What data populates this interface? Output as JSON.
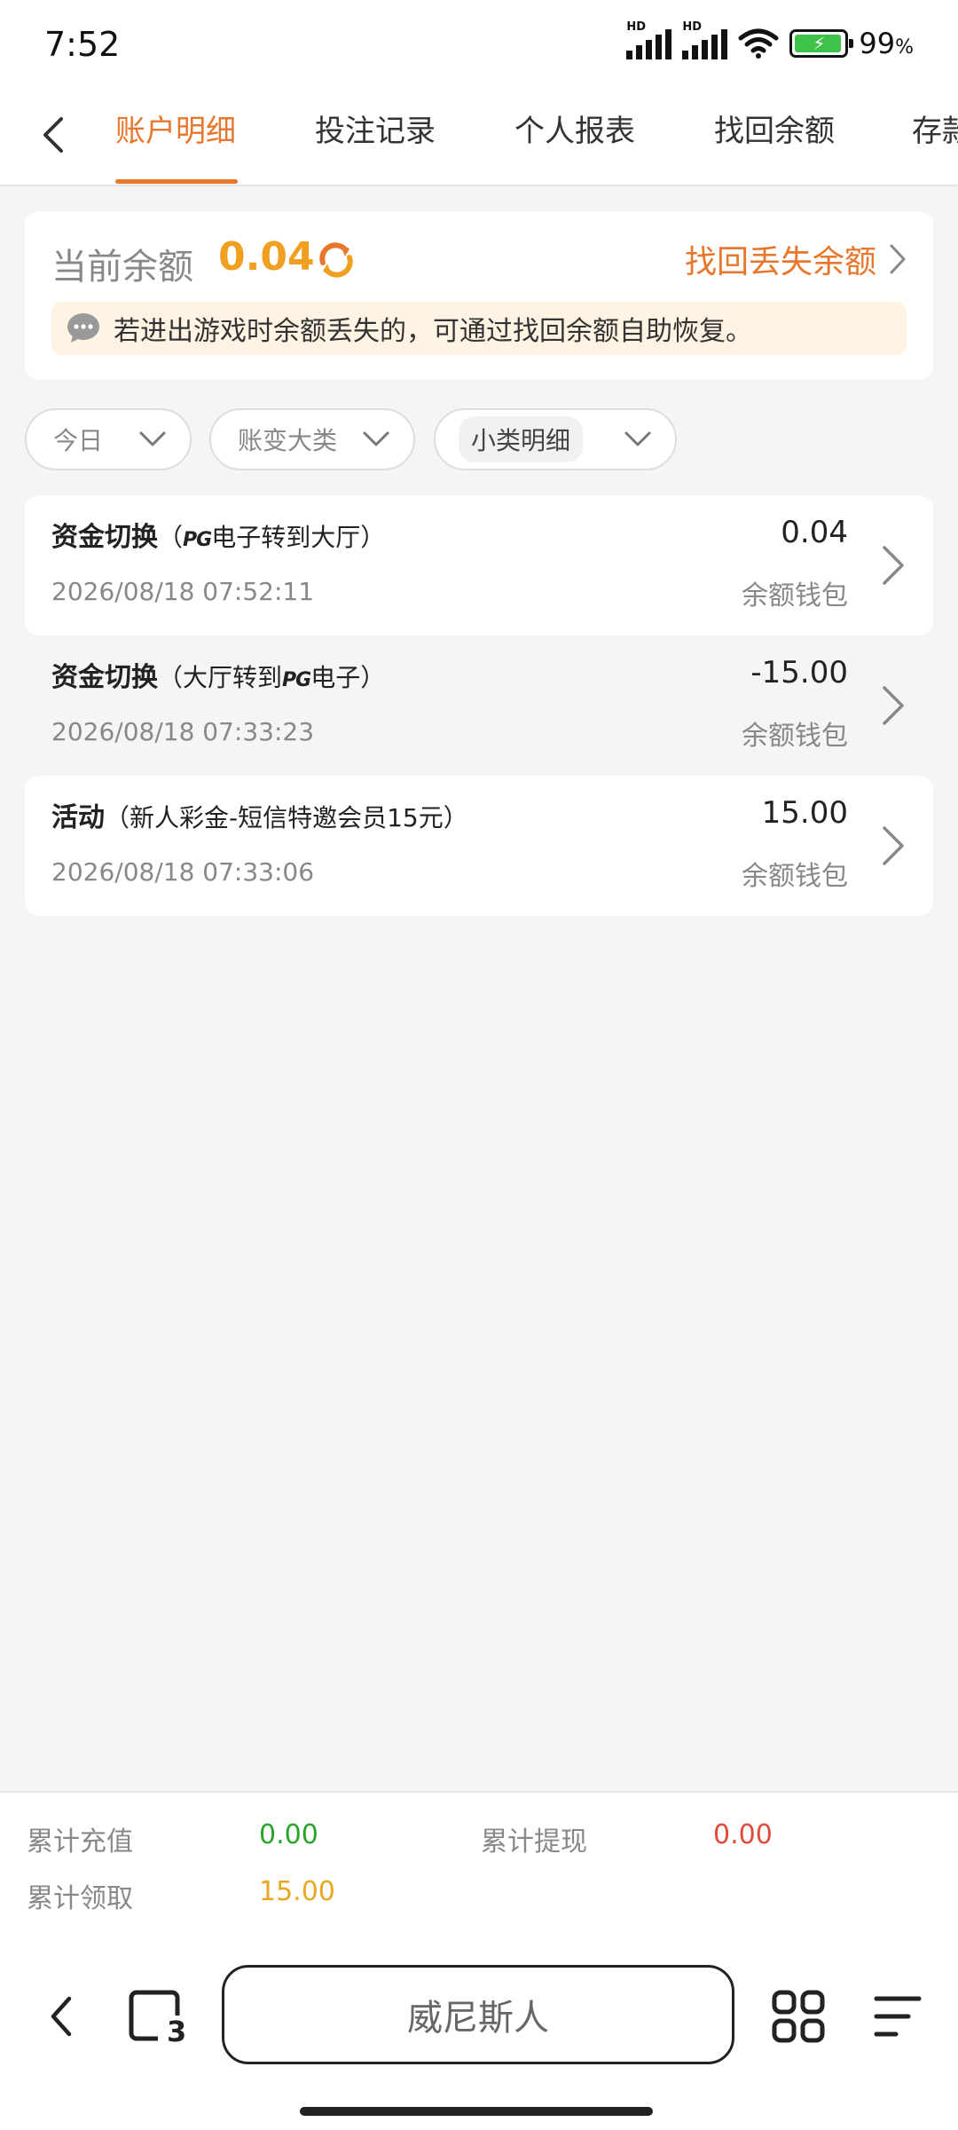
{
  "status_bar": {
    "time": "7:52",
    "battery_pct": "99",
    "battery_unit": "%"
  },
  "tabs": [
    {
      "label": "账户明细",
      "active": true
    },
    {
      "label": "投注记录"
    },
    {
      "label": "个人报表"
    },
    {
      "label": "找回余额"
    },
    {
      "label": "存款"
    }
  ],
  "balance": {
    "label": "当前余额",
    "value": "0.04",
    "recover_link": "找回丢失余额",
    "notice": "若进出游戏时余额丢失的，可通过找回余额自助恢复。"
  },
  "filters": [
    {
      "label": "今日"
    },
    {
      "label": "账变大类"
    },
    {
      "label": "小类明细"
    }
  ],
  "transactions": [
    {
      "type": "资金切换",
      "desc_pre": "（",
      "desc_logo": "PG",
      "desc_post": "电子转到大厅）",
      "time": "2026/08/18 07:52:11",
      "amount": "0.04",
      "wallet": "余额钱包"
    },
    {
      "type": "资金切换",
      "desc_pre": "（大厅转到",
      "desc_logo": "PG",
      "desc_post": "电子）",
      "time": "2026/08/18 07:33:23",
      "amount": "-15.00",
      "wallet": "余额钱包"
    },
    {
      "type": "活动",
      "desc_pre": "（新人彩金-短信特邀会员15元）",
      "desc_logo": "",
      "desc_post": "",
      "time": "2026/08/18 07:33:06",
      "amount": "15.00",
      "wallet": "余额钱包"
    }
  ],
  "summary": {
    "recharge_label": "累计充值",
    "recharge_value": "0.00",
    "withdraw_label": "累计提现",
    "withdraw_value": "0.00",
    "claimed_label": "累计领取",
    "claimed_value": "15.00"
  },
  "colors": {
    "accent": "#e8772e",
    "balance": "#f0a020",
    "green": "#2aa52a",
    "red": "#e04a3a",
    "gold": "#e6a820"
  },
  "browser": {
    "site_name": "威尼斯人",
    "tab_count": "3"
  }
}
